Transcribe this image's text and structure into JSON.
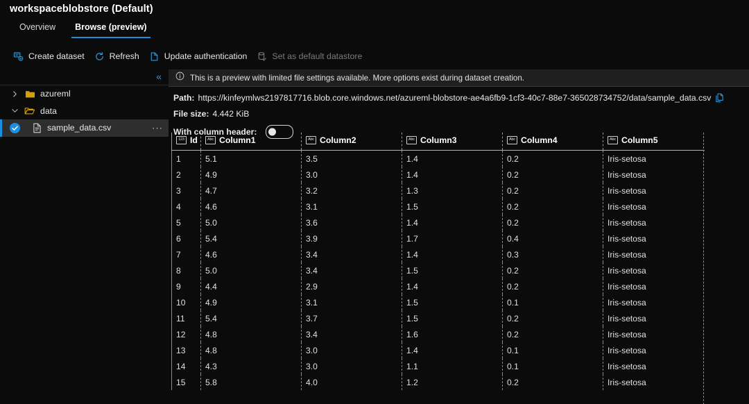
{
  "header": {
    "title": "workspaceblobstore (Default)"
  },
  "tabs": [
    {
      "label": "Overview",
      "active": false
    },
    {
      "label": "Browse (preview)",
      "active": true
    }
  ],
  "toolbar": {
    "create_dataset": "Create dataset",
    "refresh": "Refresh",
    "update_authentication": "Update authentication",
    "set_as_default": "Set as default datastore"
  },
  "sidebar": {
    "collapse_label": "«",
    "items": [
      {
        "label": "azureml",
        "type": "folder",
        "expanded": false,
        "selected": false
      },
      {
        "label": "data",
        "type": "folder-open",
        "expanded": true,
        "selected": false
      },
      {
        "label": "sample_data.csv",
        "type": "file",
        "expanded": false,
        "selected": true
      }
    ],
    "overflow_label": "···"
  },
  "info": {
    "message": "This is a preview with limited file settings available. More options exist during dataset creation."
  },
  "details": {
    "path_label": "Path:",
    "path_value": "https://kinfeymlws2197817716.blob.core.windows.net/azureml-blobstore-ae4a6fb9-1cf3-40c7-88e7-365028734752/data/sample_data.csv",
    "filesize_label": "File size:",
    "filesize_value": "4.442 KiB",
    "column_header_label": "With column header:",
    "column_header_on": false
  },
  "colors": {
    "accent": "#1a8fe0",
    "background": "#0b0b0b",
    "selected_row": "#2e2e2e",
    "folder": "#d2a000",
    "disabled_text": "#7b7b7b"
  },
  "table": {
    "columns": [
      {
        "name": "Id",
        "type": "numeric"
      },
      {
        "name": "Column1",
        "type": "text"
      },
      {
        "name": "Column2",
        "type": "text"
      },
      {
        "name": "Column3",
        "type": "text"
      },
      {
        "name": "Column4",
        "type": "text"
      },
      {
        "name": "Column5",
        "type": "text"
      }
    ],
    "rows": [
      [
        "1",
        "5.1",
        "3.5",
        "1.4",
        "0.2",
        "Iris-setosa"
      ],
      [
        "2",
        "4.9",
        "3.0",
        "1.4",
        "0.2",
        "Iris-setosa"
      ],
      [
        "3",
        "4.7",
        "3.2",
        "1.3",
        "0.2",
        "Iris-setosa"
      ],
      [
        "4",
        "4.6",
        "3.1",
        "1.5",
        "0.2",
        "Iris-setosa"
      ],
      [
        "5",
        "5.0",
        "3.6",
        "1.4",
        "0.2",
        "Iris-setosa"
      ],
      [
        "6",
        "5.4",
        "3.9",
        "1.7",
        "0.4",
        "Iris-setosa"
      ],
      [
        "7",
        "4.6",
        "3.4",
        "1.4",
        "0.3",
        "Iris-setosa"
      ],
      [
        "8",
        "5.0",
        "3.4",
        "1.5",
        "0.2",
        "Iris-setosa"
      ],
      [
        "9",
        "4.4",
        "2.9",
        "1.4",
        "0.2",
        "Iris-setosa"
      ],
      [
        "10",
        "4.9",
        "3.1",
        "1.5",
        "0.1",
        "Iris-setosa"
      ],
      [
        "11",
        "5.4",
        "3.7",
        "1.5",
        "0.2",
        "Iris-setosa"
      ],
      [
        "12",
        "4.8",
        "3.4",
        "1.6",
        "0.2",
        "Iris-setosa"
      ],
      [
        "13",
        "4.8",
        "3.0",
        "1.4",
        "0.1",
        "Iris-setosa"
      ],
      [
        "14",
        "4.3",
        "3.0",
        "1.1",
        "0.1",
        "Iris-setosa"
      ],
      [
        "15",
        "5.8",
        "4.0",
        "1.2",
        "0.2",
        "Iris-setosa"
      ]
    ]
  }
}
